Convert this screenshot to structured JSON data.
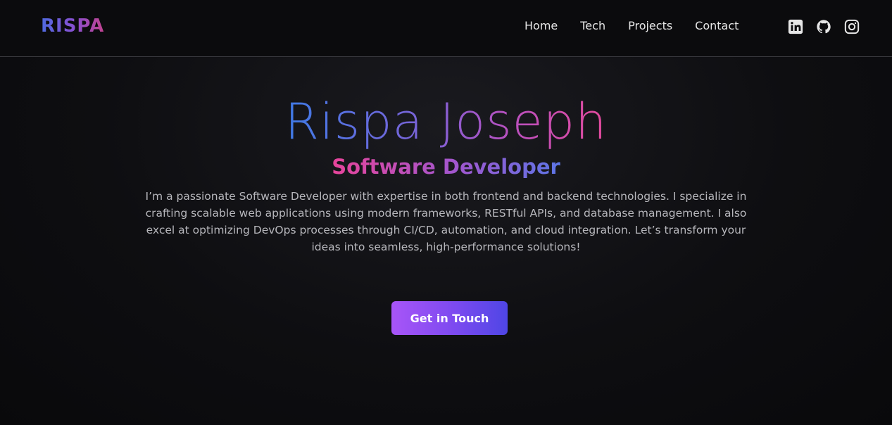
{
  "navbar": {
    "logo": "RISPA",
    "links": [
      {
        "label": "Home"
      },
      {
        "label": "Tech"
      },
      {
        "label": "Projects"
      },
      {
        "label": "Contact"
      }
    ],
    "socials": [
      {
        "icon": "linkedin-icon"
      },
      {
        "icon": "github-icon"
      },
      {
        "icon": "instagram-icon"
      }
    ]
  },
  "hero": {
    "name": "Rispa Joseph",
    "role": "Software Developer",
    "description": "I’m a passionate Software Developer with expertise in both frontend and backend technologies. I specialize in crafting scalable web applications using modern frameworks, RESTful APIs, and database management. I also excel at optimizing DevOps processes through CI/CD, automation, and cloud integration. Let’s transform your ideas into seamless, high-performance solutions!",
    "cta_label": "Get in Touch"
  },
  "colors": {
    "background": "#0e0e11",
    "nav_text": "#e6e6e6",
    "description_text": "#b7b7bc",
    "gradient_blue": "#3f7ae6",
    "gradient_pink": "#e24a9b",
    "button_start": "#a855f7",
    "button_end": "#4f46e5"
  }
}
